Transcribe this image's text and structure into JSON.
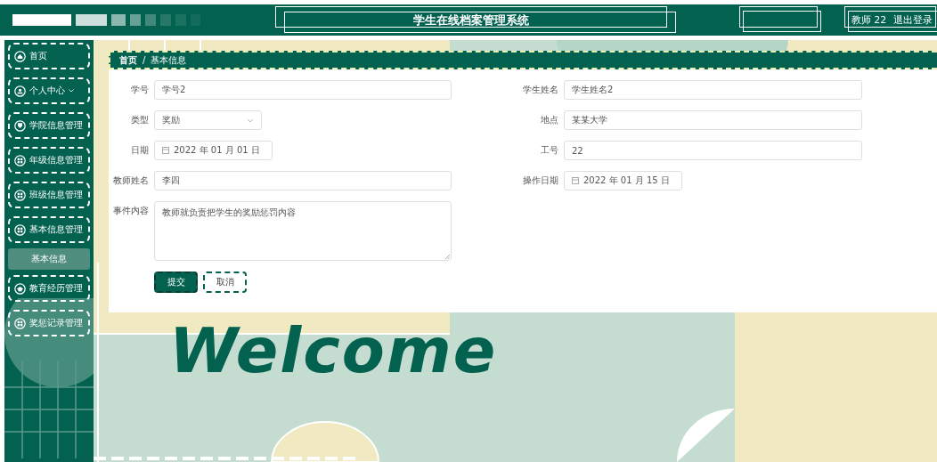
{
  "header": {
    "title": "学生在线档案管理系统",
    "user": "教师 22",
    "logout": "退出登录"
  },
  "sidebar": {
    "items": [
      {
        "label": "首页",
        "kind": "home",
        "selected": false
      },
      {
        "label": "个人中心",
        "kind": "user",
        "selected": false,
        "expandable": true
      },
      {
        "label": "学院信息管理",
        "kind": "badge",
        "selected": false
      },
      {
        "label": "年级信息管理",
        "kind": "grid",
        "selected": false
      },
      {
        "label": "班级信息管理",
        "kind": "grid",
        "selected": false
      },
      {
        "label": "基本信息管理",
        "kind": "grid",
        "selected": false,
        "children": [
          {
            "label": "基本信息",
            "selected": true
          }
        ]
      },
      {
        "label": "教育经历管理",
        "kind": "cap",
        "selected": false
      },
      {
        "label": "奖惩记录管理",
        "kind": "grid",
        "selected": false
      }
    ]
  },
  "breadcrumb": {
    "items": [
      "首页",
      "基本信息"
    ],
    "separator": "/"
  },
  "form": {
    "left": [
      {
        "label": "学号",
        "kind": "text",
        "value": "学号2"
      },
      {
        "label": "类型",
        "kind": "select",
        "value": "奖励"
      },
      {
        "label": "日期",
        "kind": "date",
        "value": "2022 年 01 月 01 日"
      },
      {
        "label": "教师姓名",
        "kind": "text",
        "value": "李四"
      },
      {
        "label": "事件内容",
        "kind": "textarea",
        "value": "教师就负责把学生的奖励惩罚内容"
      }
    ],
    "right": [
      {
        "label": "学生姓名",
        "kind": "text",
        "value": "学生姓名2"
      },
      {
        "label": "地点",
        "kind": "text",
        "value": "某某大学"
      },
      {
        "label": "工号",
        "kind": "text",
        "value": "22"
      },
      {
        "label": "操作日期",
        "kind": "date",
        "value": "2022 年 01 月 15 日"
      }
    ],
    "buttons": [
      {
        "label": "提交",
        "kind": "primary"
      },
      {
        "label": "取消",
        "kind": "secondary"
      }
    ]
  },
  "welcome": "Welcome"
}
